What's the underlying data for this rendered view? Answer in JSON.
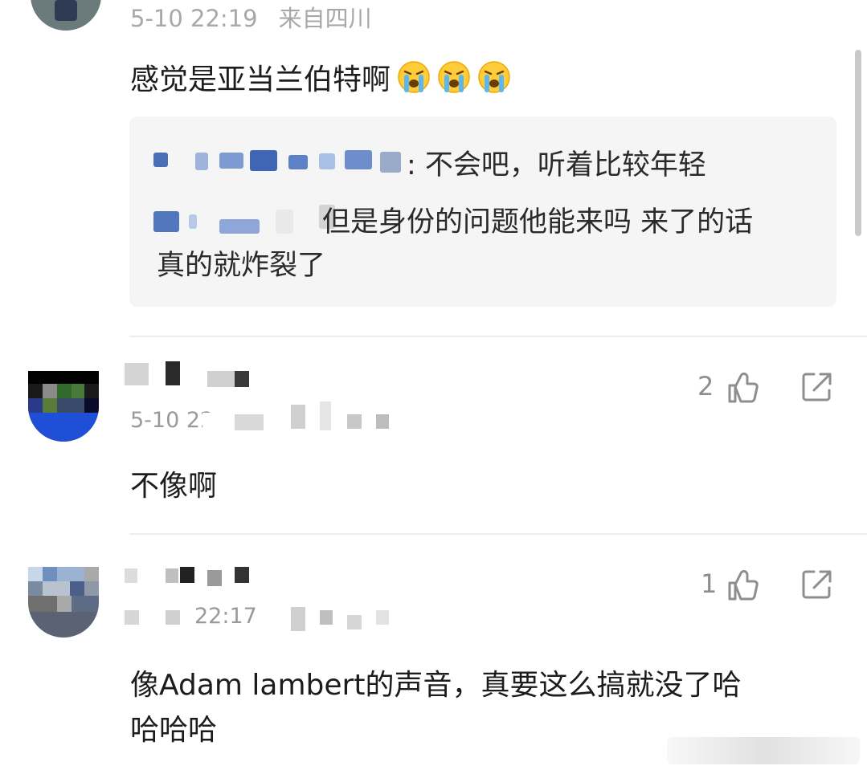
{
  "comments": [
    {
      "meta_time": "5-10 22:19",
      "meta_location": "来自四川",
      "text": "感觉是亚当兰伯特啊",
      "emoji_icons": [
        "crying-face-icon",
        "crying-face-icon",
        "crying-face-icon"
      ],
      "replies": [
        {
          "text_visible": ": 不会吧，听着比较年轻"
        },
        {
          "text_line1": "但是身份的问题他能来吗 来了的话",
          "text_line2": "真的就炸裂了"
        }
      ]
    },
    {
      "likes": "2",
      "text": "不像啊",
      "meta_time_partial": "5-10 22"
    },
    {
      "likes": "1",
      "text_line1": "像Adam lambert的声音，真要这么搞就没了哈",
      "text_line2": "哈哈哈",
      "meta_time_partial": "22:17"
    }
  ],
  "colors": {
    "meta_gray": "#a8a8a8",
    "reply_bg": "#f5f5f5",
    "icon_gray": "#8e8e8e",
    "divider": "#ededed"
  }
}
